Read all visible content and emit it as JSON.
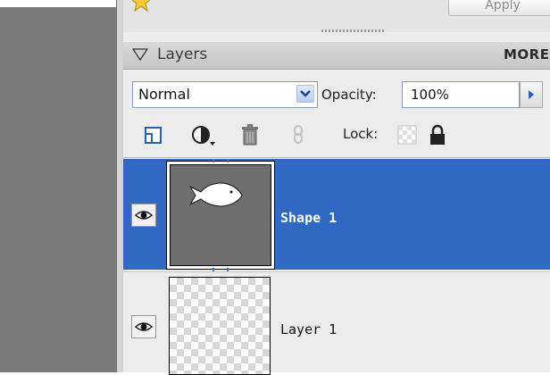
{
  "toolbar": {
    "apply_label": "Apply"
  },
  "layers_panel": {
    "title": "Layers",
    "more_label": "MORE",
    "blend_mode": {
      "value": "Normal"
    },
    "opacity": {
      "label": "Opacity:",
      "value": "100%"
    },
    "lock_label": "Lock:",
    "layers": [
      {
        "name": "Shape 1",
        "visible": true,
        "selected": true
      },
      {
        "name": "Layer 1",
        "visible": true,
        "selected": false
      }
    ]
  },
  "colors": {
    "selection": "#3068c4",
    "panel": "#ececec",
    "canvas_gray": "#7b7b7b"
  }
}
